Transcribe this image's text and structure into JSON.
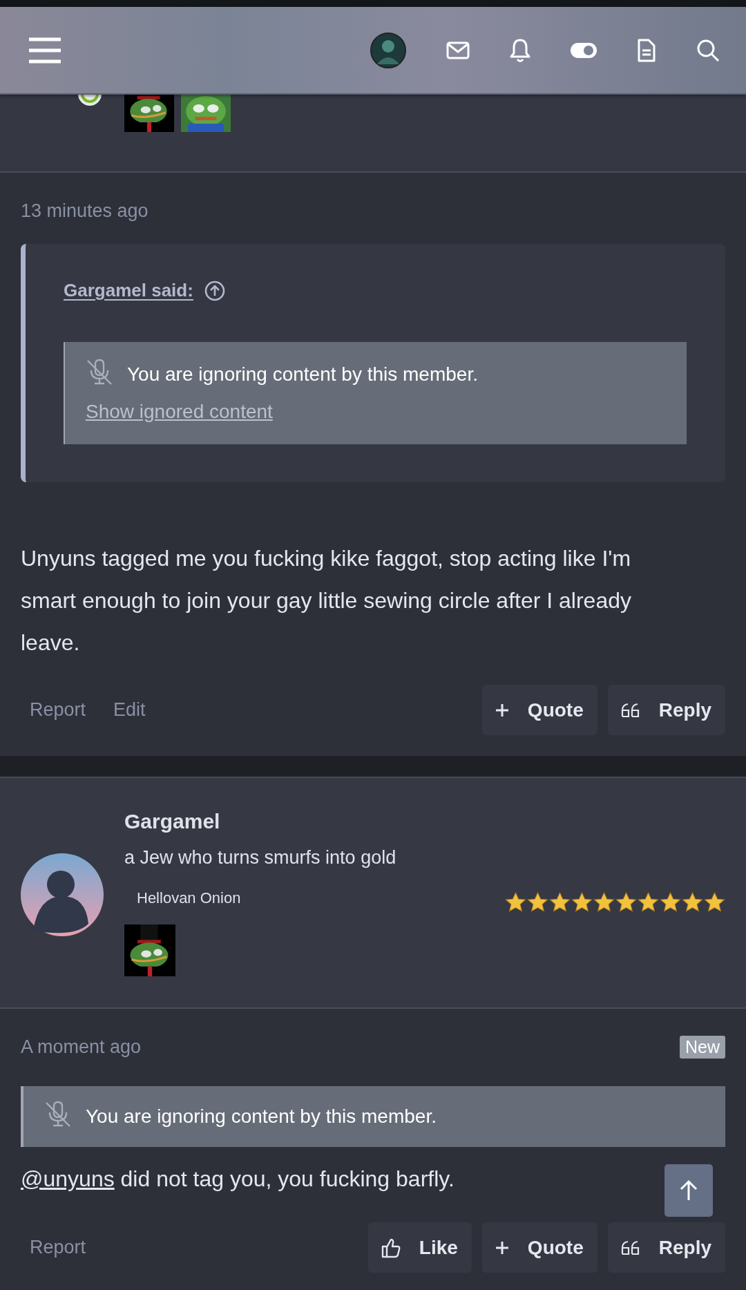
{
  "previous_post": {
    "badges": [
      {
        "kind": "picture"
      },
      {
        "kind": "picture"
      }
    ]
  },
  "first_post": {
    "time": "13 minutes ago",
    "quote": {
      "author_link": "Gargamel said:",
      "notice": "You are ignoring content by this member.",
      "show_link": "Show ignored content"
    },
    "text": "Unyuns tagged me you fucking kike faggot, stop acting like I'm smart enough to join your gay little sewing circle after I already leave.",
    "links": [
      "Report",
      "Edit"
    ],
    "buttons": [
      {
        "kind": "quote",
        "label": "Quote"
      },
      {
        "kind": "reply",
        "label": "Reply"
      }
    ]
  },
  "user": {
    "name": "Gargamel",
    "title": "a Jew who turns smurfs into gold",
    "banner": "Hellovan Onion",
    "stars": 10,
    "badges": [
      {
        "kind": "picture"
      }
    ]
  },
  "second_post": {
    "time": "A moment ago",
    "badge": "New",
    "notice": "You are ignoring content by this member.",
    "mention": "@unyuns",
    "text": "did not tag you, you fucking barfly.",
    "links": [
      "Report"
    ],
    "buttons": [
      {
        "kind": "like",
        "label": "Like"
      },
      {
        "kind": "quote",
        "label": "Quote"
      },
      {
        "kind": "reply",
        "label": "Reply"
      }
    ]
  }
}
